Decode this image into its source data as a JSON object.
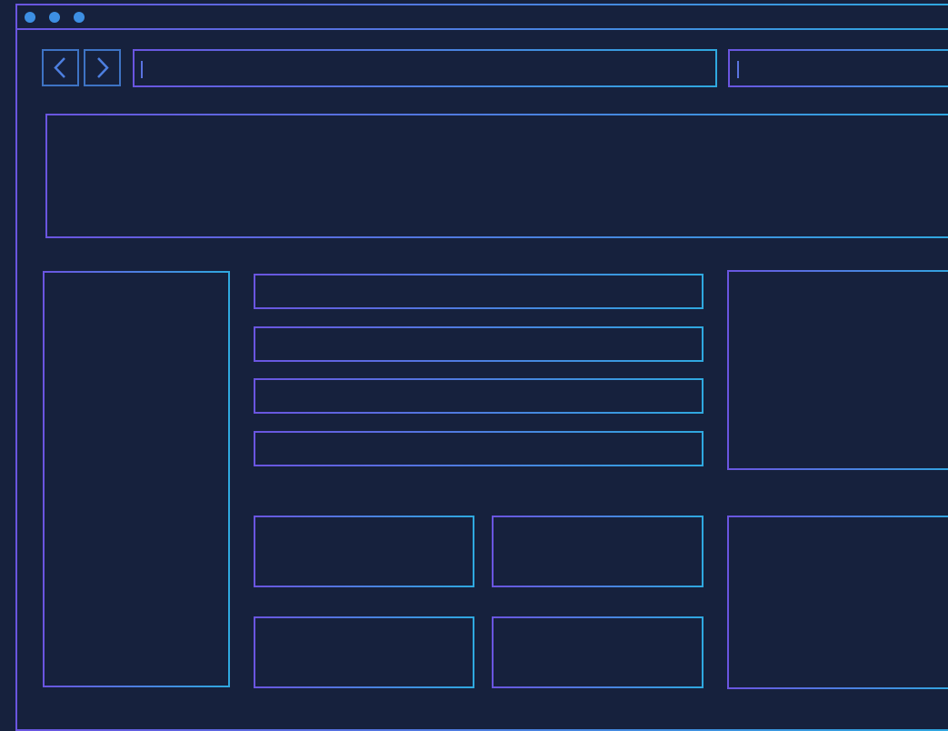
{
  "window": {
    "controls": [
      "dot",
      "dot",
      "dot"
    ]
  },
  "toolbar": {
    "back_icon": "chevron-left-icon",
    "forward_icon": "chevron-right-icon",
    "address_bar_value": "",
    "search_bar_value": ""
  },
  "colors": {
    "background": "#16213d",
    "stroke_start": "#6a55e0",
    "stroke_end": "#2fa8df",
    "dot": "#3d8fe3"
  },
  "content": {
    "banner": "",
    "sidebar": "",
    "list_rows": [
      "",
      "",
      "",
      ""
    ],
    "cards": [
      "",
      "",
      "",
      ""
    ],
    "right_panels": [
      "",
      ""
    ]
  }
}
